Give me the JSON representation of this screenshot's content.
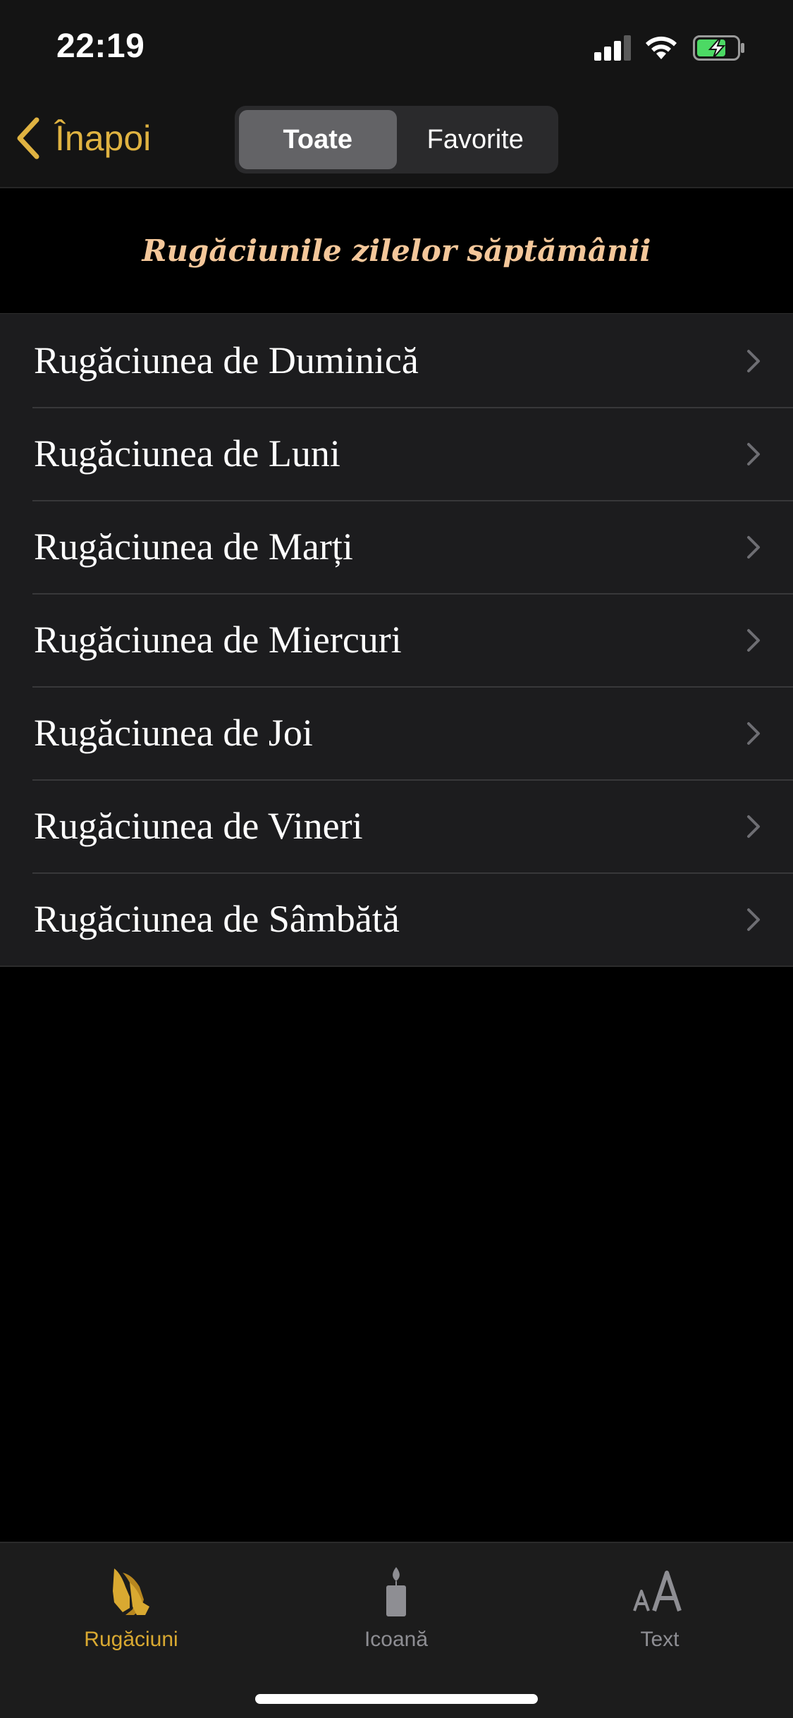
{
  "status_bar": {
    "time": "22:19",
    "icons": [
      "cellular-signal-icon",
      "wifi-icon",
      "battery-charging-icon"
    ]
  },
  "nav": {
    "back_label": "Înapoi",
    "segments": [
      {
        "label": "Toate",
        "selected": true
      },
      {
        "label": "Favorite",
        "selected": false
      }
    ]
  },
  "section": {
    "title": "Rugăciunile zilelor săptămânii"
  },
  "prayers": [
    {
      "label": "Rugăciunea de Duminică"
    },
    {
      "label": "Rugăciunea de Luni"
    },
    {
      "label": "Rugăciunea de Marți"
    },
    {
      "label": "Rugăciunea de Miercuri"
    },
    {
      "label": "Rugăciunea de Joi"
    },
    {
      "label": "Rugăciunea de Vineri"
    },
    {
      "label": "Rugăciunea de Sâmbătă"
    }
  ],
  "tab_bar": {
    "tabs": [
      {
        "label": "Rugăciuni",
        "icon": "praying-hands-icon",
        "active": true
      },
      {
        "label": "Icoană",
        "icon": "candle-icon",
        "active": false
      },
      {
        "label": "Text",
        "icon": "text-size-icon",
        "active": false
      }
    ]
  },
  "colors": {
    "accent": "#e0b341",
    "section_title": "#f4c79a",
    "background": "#000000",
    "row_background": "#1c1c1e",
    "inactive_tab": "#8e8e93"
  }
}
